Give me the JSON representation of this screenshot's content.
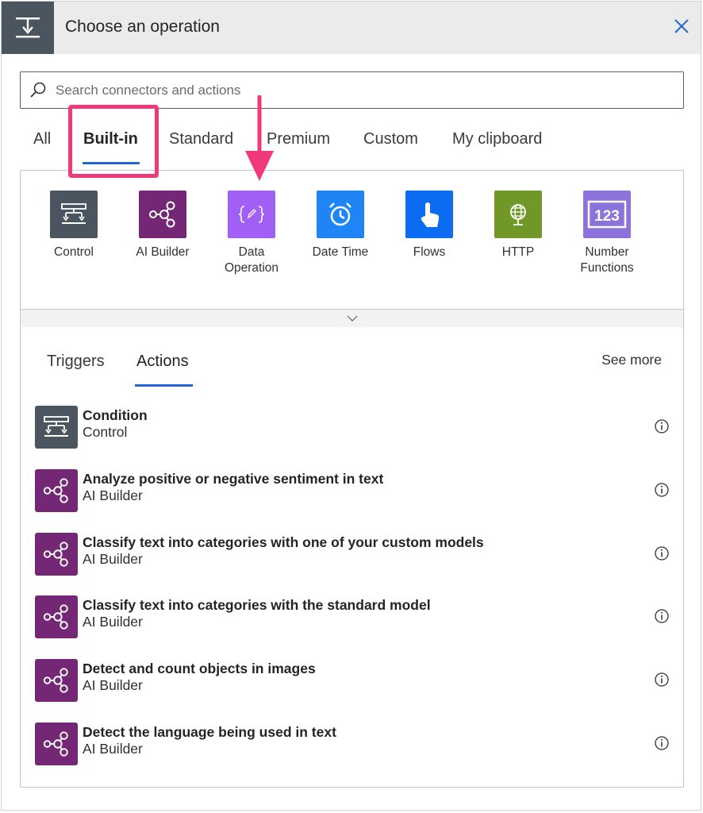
{
  "header": {
    "title": "Choose an operation"
  },
  "search": {
    "placeholder": "Search connectors and actions"
  },
  "category_tabs": [
    {
      "label": "All"
    },
    {
      "label": "Built-in",
      "selected": true
    },
    {
      "label": "Standard"
    },
    {
      "label": "Premium"
    },
    {
      "label": "Custom"
    },
    {
      "label": "My clipboard"
    }
  ],
  "connectors": [
    {
      "label": "Control",
      "icon": "control-icon",
      "color": "#4a5560"
    },
    {
      "label": "AI Builder",
      "icon": "ai-builder-icon",
      "color": "#742774"
    },
    {
      "label": "Data\nOperation",
      "icon": "data-operation-icon",
      "color": "#a25ff5"
    },
    {
      "label": "Date Time",
      "icon": "clock-icon",
      "color": "#1f85f5"
    },
    {
      "label": "Flows",
      "icon": "touch-icon",
      "color": "#0b6cf1"
    },
    {
      "label": "HTTP",
      "icon": "globe-icon",
      "color": "#709727"
    },
    {
      "label": "Number\nFunctions",
      "icon": "number-icon",
      "color": "#8b73db"
    }
  ],
  "sub_tabs": [
    {
      "label": "Triggers"
    },
    {
      "label": "Actions",
      "selected": true
    }
  ],
  "see_more": "See more",
  "actions": [
    {
      "title": "Condition",
      "connector": "Control",
      "icon": "control-icon",
      "color": "#4a5560"
    },
    {
      "title": "Analyze positive or negative sentiment in text",
      "connector": "AI Builder",
      "icon": "ai-builder-icon",
      "color": "#742774"
    },
    {
      "title": "Classify text into categories with one of your custom models",
      "connector": "AI Builder",
      "icon": "ai-builder-icon",
      "color": "#742774"
    },
    {
      "title": "Classify text into categories with the standard model",
      "connector": "AI Builder",
      "icon": "ai-builder-icon",
      "color": "#742774"
    },
    {
      "title": "Detect and count objects in images",
      "connector": "AI Builder",
      "icon": "ai-builder-icon",
      "color": "#742774"
    },
    {
      "title": "Detect the language being used in text",
      "connector": "AI Builder",
      "icon": "ai-builder-icon",
      "color": "#742774"
    }
  ],
  "colors": {
    "accent": "#2266d3",
    "annotation": "#f0397a"
  }
}
